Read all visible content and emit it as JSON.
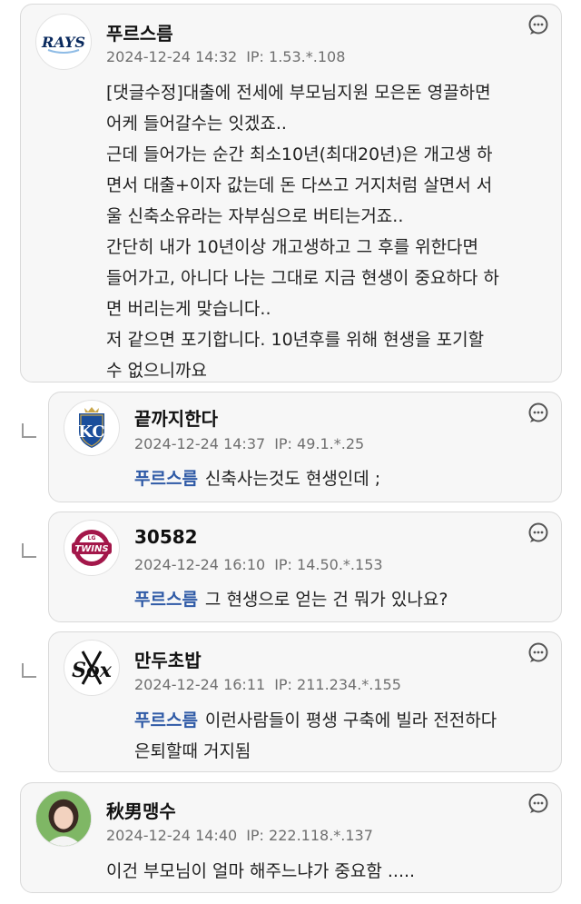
{
  "comments": [
    {
      "nick": "푸르스름",
      "date": "2024-12-24 14:32",
      "ip": "IP: 1.53.*.108",
      "logo_text": "RAYS",
      "lines": [
        "[댓글수정]대출에 전세에 부모님지원 모은돈 영끌하면",
        "어케 들어갈수는 잇겠죠..",
        "근데 들어가는 순간 최소10년(최대20년)은 개고생 하",
        "면서 대출+이자 값는데 돈 다쓰고 거지처럼 살면서 서",
        "울 신축소유라는 자부심으로 버티는거죠..",
        "간단히 내가 10년이상 개고생하고 그 후를 위한다면",
        "들어가고, 아니다 나는 그대로 지금 현생이 중요하다 하",
        "면 버리는게 맞습니다..",
        "저 같으면 포기합니다. 10년후를 위해 현생을 포기할",
        "수 없으니까요"
      ]
    },
    {
      "nick": "끝까지한다",
      "date": "2024-12-24 14:37",
      "ip": "IP: 49.1.*.25",
      "logo_text": "KC",
      "mention": "푸르스름",
      "lines": [
        "신축사는것도 현생인데 ;"
      ]
    },
    {
      "nick": "30582",
      "date": "2024-12-24 16:10",
      "ip": "IP: 14.50.*.153",
      "logo_text": "TWINS",
      "logo_sub": "LG",
      "mention": "푸르스름",
      "lines": [
        "그 현생으로 얻는 건 뭐가 있나요?"
      ]
    },
    {
      "nick": "만두초밥",
      "date": "2024-12-24 16:11",
      "ip": "IP: 211.234.*.155",
      "logo_text": "Sox",
      "mention": "푸르스름",
      "lines": [
        "이런사람들이 평생 구축에 빌라 전전하다",
        "은퇴할때 거지됨"
      ]
    },
    {
      "nick": "秋男맹수",
      "date": "2024-12-24 14:40",
      "ip": "IP: 222.118.*.137",
      "lines": [
        "이건 부모님이 얼마 해주느냐가 중요함 ....."
      ]
    }
  ],
  "colors": {
    "card_bg": "#f7f7f7",
    "mention": "#2f5aa6",
    "rays_navy": "#0a2a5e",
    "kc_blue": "#1b4e9b",
    "twins_red": "#a3174a"
  },
  "icons": {
    "comment": "speech-bubble-icon",
    "reply": "reply-arrow-icon"
  }
}
